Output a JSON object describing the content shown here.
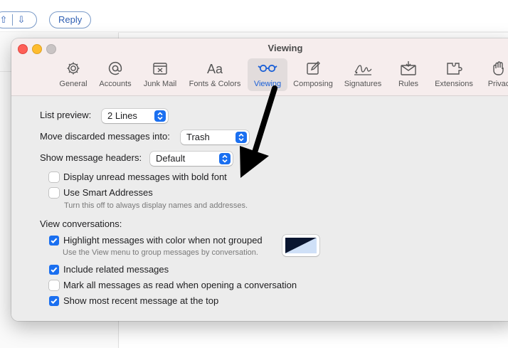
{
  "background_app": {
    "reply_label": "Reply",
    "up_arrow": "⇧",
    "down_arrow": "⇩"
  },
  "window": {
    "title": "Viewing",
    "traffic_lights": [
      "close",
      "minimize",
      "zoom"
    ]
  },
  "tabs": [
    {
      "label": "General",
      "icon": "gear-icon"
    },
    {
      "label": "Accounts",
      "icon": "at-sign-icon"
    },
    {
      "label": "Junk Mail",
      "icon": "junk-tray-icon"
    },
    {
      "label": "Fonts & Colors",
      "icon": "font-aa-icon"
    },
    {
      "label": "Viewing",
      "icon": "glasses-icon",
      "active": true
    },
    {
      "label": "Composing",
      "icon": "compose-icon"
    },
    {
      "label": "Signatures",
      "icon": "signature-icon"
    },
    {
      "label": "Rules",
      "icon": "rules-envelope-icon"
    },
    {
      "label": "Extensions",
      "icon": "puzzle-icon"
    },
    {
      "label": "Privac",
      "icon": "hand-icon"
    }
  ],
  "settings": {
    "list_preview": {
      "label": "List preview:",
      "value": "2 Lines"
    },
    "move_discarded": {
      "label": "Move discarded messages into:",
      "value": "Trash"
    },
    "show_headers": {
      "label": "Show message headers:",
      "value": "Default"
    },
    "bold_unread": {
      "label": "Display unread messages with bold font",
      "checked": false
    },
    "smart_addresses": {
      "label": "Use Smart Addresses",
      "checked": false,
      "hint": "Turn this off to always display names and addresses."
    },
    "view_conversations_heading": "View conversations:",
    "highlight": {
      "label": "Highlight messages with color when not grouped",
      "checked": true,
      "hint": "Use the View menu to group messages by conversation."
    },
    "include_related": {
      "label": "Include related messages",
      "checked": true
    },
    "mark_all_read": {
      "label": "Mark all messages as read when opening a conversation",
      "checked": false
    },
    "most_recent_top": {
      "label": "Show most recent message at the top",
      "checked": true
    }
  },
  "colors": {
    "accent": "#1a6ff0",
    "active_tab_text": "#1a5fd6",
    "highlight_swatch_dark": "#0a1630",
    "highlight_swatch_light": "#cfe0f7"
  }
}
